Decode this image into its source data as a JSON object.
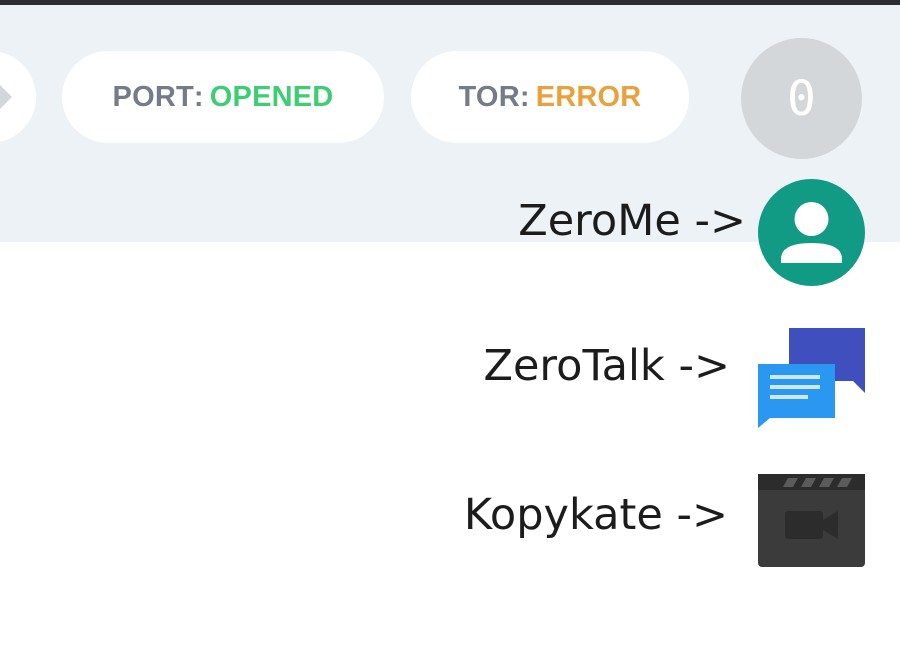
{
  "status_bar": {
    "port": {
      "key": "PORT",
      "separator": ":",
      "value": "OPENED",
      "value_color": "#3fcd73"
    },
    "tor": {
      "key": "TOR",
      "separator": ":",
      "value": "ERROR",
      "value_color": "#e9a23b"
    },
    "notification_count": "0"
  },
  "app_menu": {
    "items": [
      {
        "label": "ZeroMe ->",
        "icon": "user-avatar-icon",
        "icon_color": "#129b84"
      },
      {
        "label": "ZeroTalk ->",
        "icon": "chat-bubbles-icon",
        "icon_color": "#3f51b5"
      },
      {
        "label": "Kopykate ->",
        "icon": "video-clapperboard-icon",
        "icon_color": "#3b3b3b"
      }
    ]
  }
}
